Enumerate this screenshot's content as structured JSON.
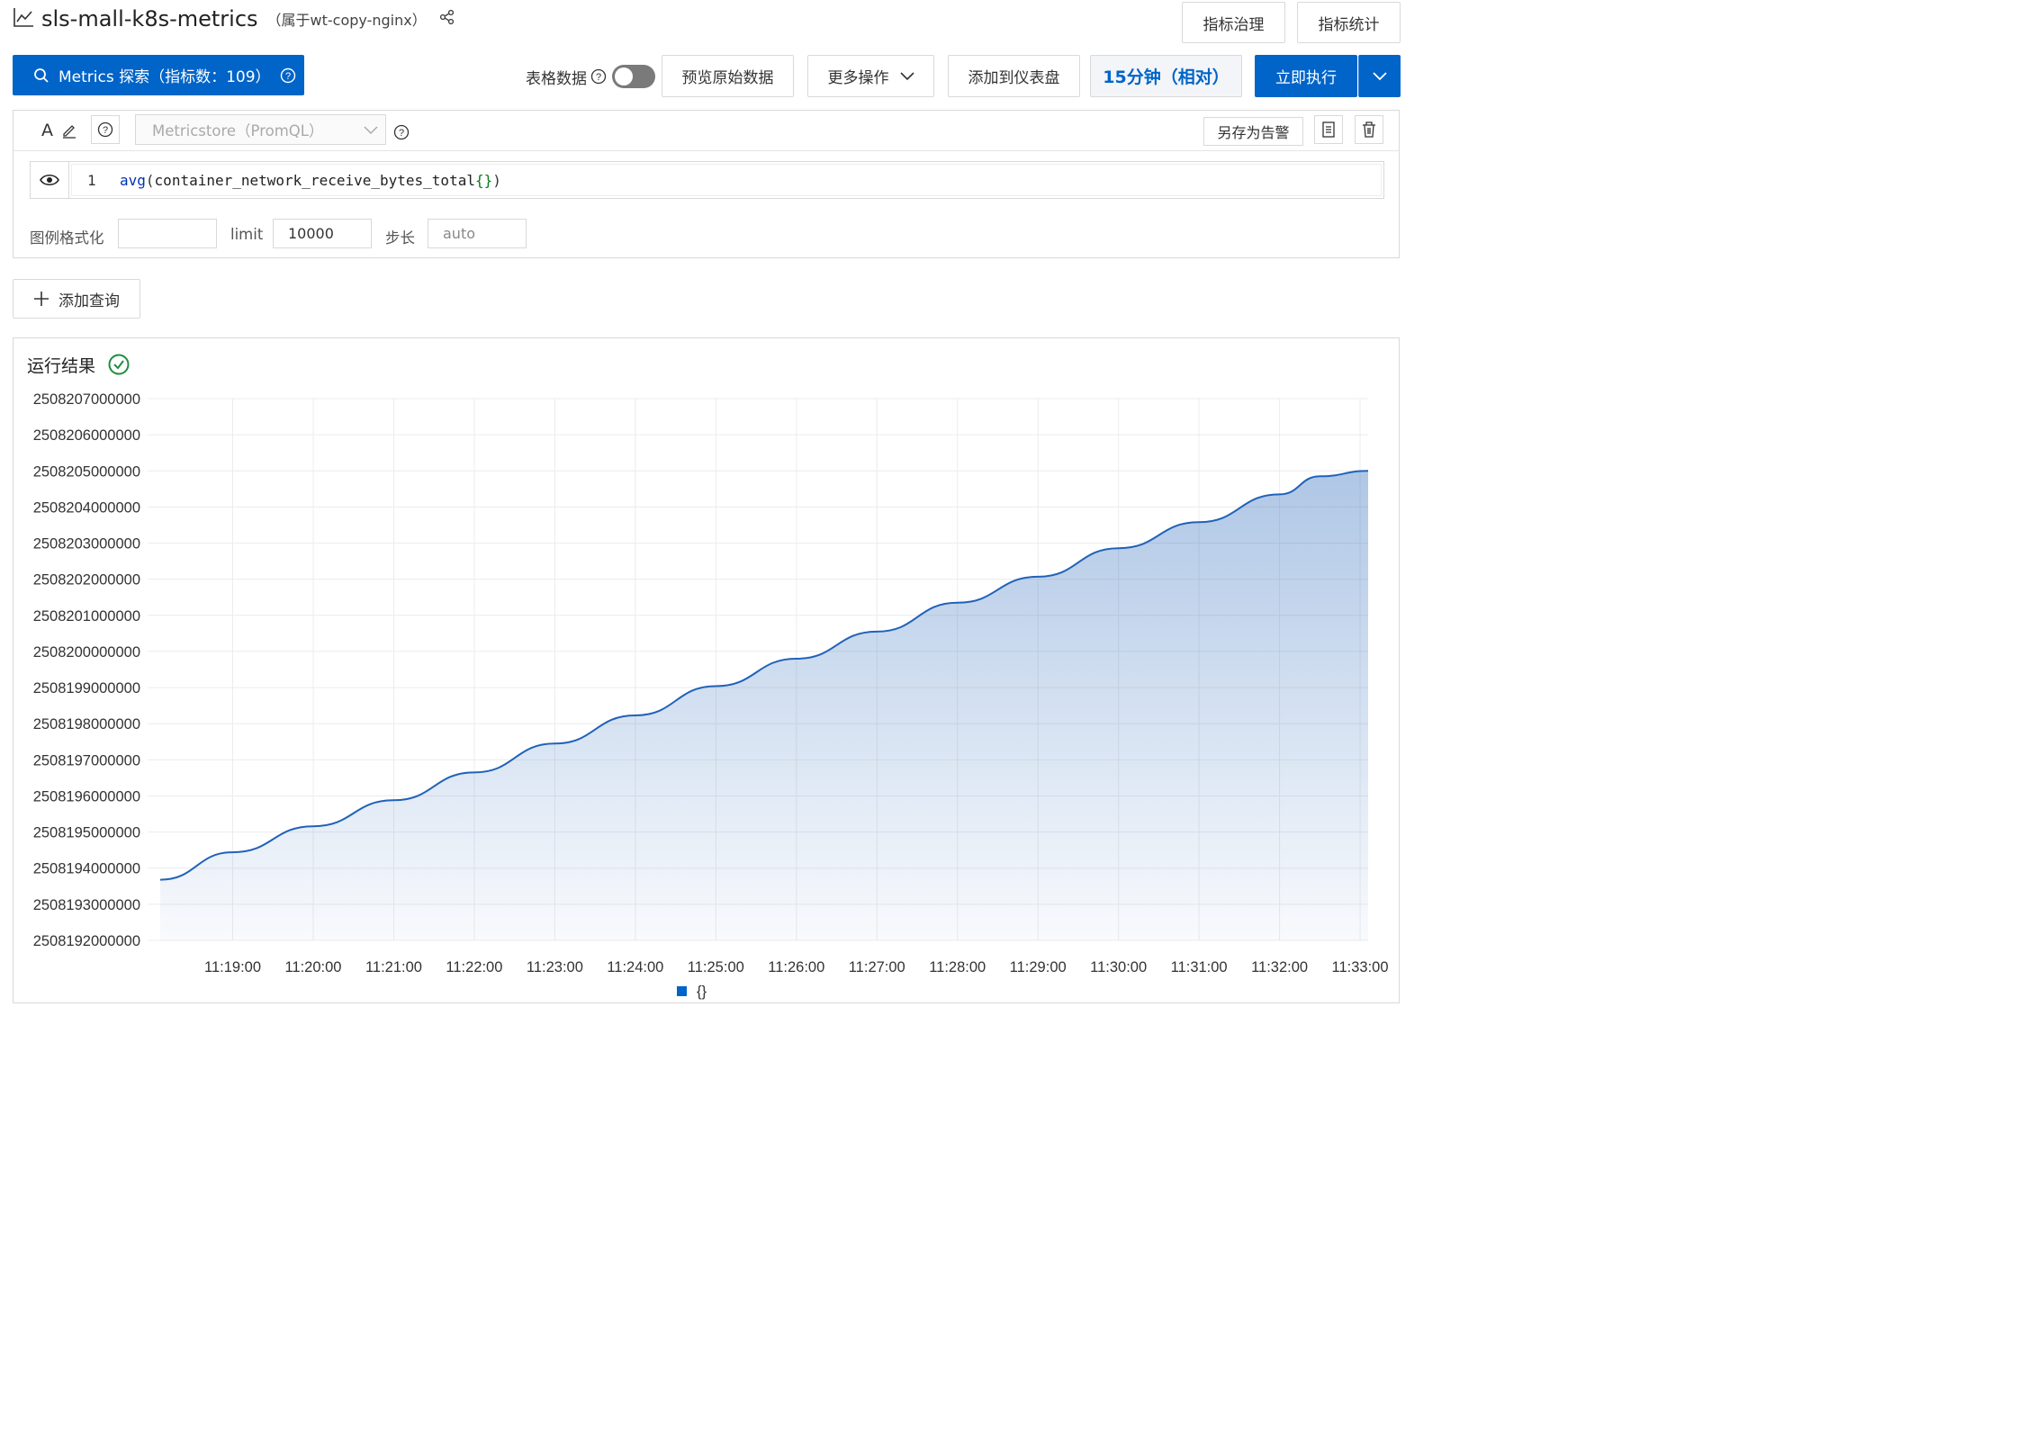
{
  "header": {
    "title": "sls-mall-k8s-metrics",
    "subtitle": "（属于wt-copy-nginx）",
    "btn_metrics_governance": "指标治理",
    "btn_metrics_stats": "指标统计"
  },
  "toolbar": {
    "metrics_explore": "Metrics 探索（指标数：109）",
    "table_data_label": "表格数据",
    "preview_raw": "预览原始数据",
    "more_ops": "更多操作",
    "add_dashboard": "添加到仪表盘",
    "time_range": "15分钟（相对）",
    "run_now": "立即执行"
  },
  "query": {
    "letter": "A",
    "store_placeholder": "Metricstore（PromQL）",
    "save_alert": "另存为告警",
    "line_number": "1",
    "code_fn": "avg",
    "code_open": "(",
    "code_metric": "container_network_receive_bytes_total",
    "code_braces": "{}",
    "code_close": ")",
    "legend_format_label": "图例格式化",
    "legend_format_value": "",
    "limit_label": "limit",
    "limit_value": "10000",
    "step_label": "步长",
    "step_placeholder": "auto"
  },
  "add_query_label": "添加查询",
  "result": {
    "title": "运行结果"
  },
  "colors": {
    "primary": "#0064c8",
    "series_line": "#2062b8",
    "success": "#1e8e3e"
  },
  "chart_data": {
    "type": "area",
    "title": "",
    "xlabel": "",
    "ylabel": "",
    "y_ticks": [
      2508192000000,
      2508193000000,
      2508194000000,
      2508195000000,
      2508196000000,
      2508197000000,
      2508198000000,
      2508199000000,
      2508200000000,
      2508201000000,
      2508202000000,
      2508203000000,
      2508204000000,
      2508205000000,
      2508206000000,
      2508207000000
    ],
    "y_tick_labels": [
      "2508192000000",
      "2508193000000",
      "2508194000000",
      "2508195000000",
      "2508196000000",
      "2508197000000",
      "2508198000000",
      "2508199000000",
      "2508200000000",
      "2508201000000",
      "2508202000000",
      "2508203000000",
      "2508204000000",
      "2508205000000",
      "2508206000000",
      "2508207000000"
    ],
    "ylim": [
      2508192000000,
      2508207000000
    ],
    "x_tick_labels": [
      "11:19:00",
      "11:20:00",
      "11:21:00",
      "11:22:00",
      "11:23:00",
      "11:24:00",
      "11:25:00",
      "11:26:00",
      "11:27:00",
      "11:28:00",
      "11:29:00",
      "11:30:00",
      "11:31:00",
      "11:32:00",
      "11:33:00"
    ],
    "x_range": [
      "11:18:06",
      "11:33:06"
    ],
    "grid": true,
    "legend_position": "bottom",
    "series": [
      {
        "name": "{}",
        "x": [
          "11:18:06",
          "11:19:00",
          "11:20:00",
          "11:21:00",
          "11:22:00",
          "11:23:00",
          "11:24:00",
          "11:25:00",
          "11:26:00",
          "11:27:00",
          "11:28:00",
          "11:29:00",
          "11:30:00",
          "11:31:00",
          "11:32:00",
          "11:32:30",
          "11:33:06"
        ],
        "values": [
          2508193680000,
          2508194440000,
          2508195160000,
          2508195880000,
          2508196650000,
          2508197450000,
          2508198230000,
          2508199040000,
          2508199800000,
          2508200550000,
          2508201350000,
          2508202070000,
          2508202860000,
          2508203580000,
          2508204350000,
          2508204850000,
          2508205000000
        ]
      }
    ]
  }
}
